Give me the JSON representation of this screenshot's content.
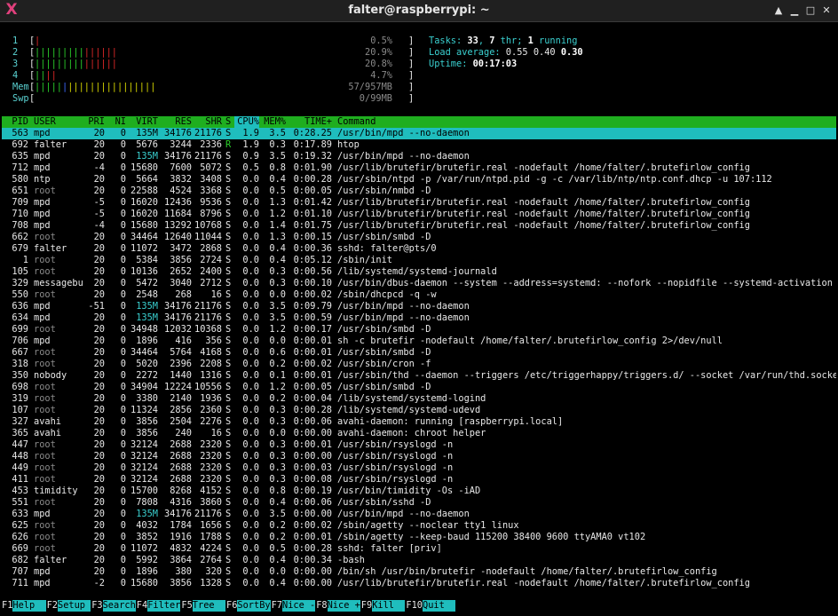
{
  "window": {
    "title": "falter@raspberrypi: ~"
  },
  "meters": {
    "cpus": [
      {
        "label": "1",
        "bars": "|",
        "value": "0.5%",
        "fraction": 0.005
      },
      {
        "label": "2",
        "bars": "|||||||||||||||",
        "value": "20.9%",
        "fraction": 0.209
      },
      {
        "label": "3",
        "bars": "|||||||||||||||",
        "value": "20.8%",
        "fraction": 0.208
      },
      {
        "label": "4",
        "bars": "||||",
        "value": "4.7%",
        "fraction": 0.047
      }
    ],
    "mem": {
      "label": "Mem",
      "bars_green": "|||||",
      "bars_blue": "|",
      "bars_yellow": "||||||||||||||||",
      "value": "57/957MB"
    },
    "swp": {
      "label": "Swp",
      "value": "0/99MB"
    }
  },
  "stats": {
    "tasks_label": "Tasks: ",
    "tasks": "33",
    "sep1": ", ",
    "threads": "7",
    "thr_label": " thr; ",
    "running": "1",
    "running_label": " running",
    "load_label": "Load average: ",
    "load1": "0.55",
    "load5": "0.40",
    "load15": "0.30",
    "uptime_label": "Uptime: ",
    "uptime": "00:17:03"
  },
  "columns": [
    "PID",
    "USER",
    "PRI",
    "NI",
    "VIRT",
    "RES",
    "SHR",
    "S",
    "CPU%",
    "MEM%",
    "TIME+",
    "Command"
  ],
  "processes": [
    [
      "563",
      "mpd",
      "20",
      "0",
      "135M",
      "34176",
      "21176",
      "S",
      "1.9",
      "3.5",
      "0:28.25",
      "/usr/bin/mpd --no-daemon"
    ],
    [
      "692",
      "falter",
      "20",
      "0",
      "5676",
      "3244",
      "2336",
      "R",
      "1.9",
      "0.3",
      "0:17.89",
      "htop"
    ],
    [
      "635",
      "mpd",
      "20",
      "0",
      "135M",
      "34176",
      "21176",
      "S",
      "0.9",
      "3.5",
      "0:19.32",
      "/usr/bin/mpd --no-daemon"
    ],
    [
      "712",
      "mpd",
      "-4",
      "0",
      "15680",
      "7600",
      "5072",
      "S",
      "0.5",
      "0.8",
      "0:01.90",
      "/usr/lib/brutefir/brutefir.real -nodefault /home/falter/.brutefirlow_config"
    ],
    [
      "580",
      "ntp",
      "20",
      "0",
      "5664",
      "3832",
      "3408",
      "S",
      "0.0",
      "0.4",
      "0:00.28",
      "/usr/sbin/ntpd -p /var/run/ntpd.pid -g -c /var/lib/ntp/ntp.conf.dhcp -u 107:112"
    ],
    [
      "651",
      "root",
      "20",
      "0",
      "22588",
      "4524",
      "3368",
      "S",
      "0.0",
      "0.5",
      "0:00.05",
      "/usr/sbin/nmbd -D"
    ],
    [
      "709",
      "mpd",
      "-5",
      "0",
      "16020",
      "12436",
      "9536",
      "S",
      "0.0",
      "1.3",
      "0:01.42",
      "/usr/lib/brutefir/brutefir.real -nodefault /home/falter/.brutefirlow_config"
    ],
    [
      "710",
      "mpd",
      "-5",
      "0",
      "16020",
      "11684",
      "8796",
      "S",
      "0.0",
      "1.2",
      "0:01.10",
      "/usr/lib/brutefir/brutefir.real -nodefault /home/falter/.brutefirlow_config"
    ],
    [
      "708",
      "mpd",
      "-4",
      "0",
      "15680",
      "13292",
      "10768",
      "S",
      "0.0",
      "1.4",
      "0:01.75",
      "/usr/lib/brutefir/brutefir.real -nodefault /home/falter/.brutefirlow_config"
    ],
    [
      "662",
      "root",
      "20",
      "0",
      "34464",
      "12640",
      "11044",
      "S",
      "0.0",
      "1.3",
      "0:00.15",
      "/usr/sbin/smbd -D"
    ],
    [
      "679",
      "falter",
      "20",
      "0",
      "11072",
      "3472",
      "2868",
      "S",
      "0.0",
      "0.4",
      "0:00.36",
      "sshd: falter@pts/0"
    ],
    [
      "1",
      "root",
      "20",
      "0",
      "5384",
      "3856",
      "2724",
      "S",
      "0.0",
      "0.4",
      "0:05.12",
      "/sbin/init"
    ],
    [
      "105",
      "root",
      "20",
      "0",
      "10136",
      "2652",
      "2400",
      "S",
      "0.0",
      "0.3",
      "0:00.56",
      "/lib/systemd/systemd-journald"
    ],
    [
      "329",
      "messagebu",
      "20",
      "0",
      "5472",
      "3040",
      "2712",
      "S",
      "0.0",
      "0.3",
      "0:00.10",
      "/usr/bin/dbus-daemon --system --address=systemd: --nofork --nopidfile --systemd-activation"
    ],
    [
      "550",
      "root",
      "20",
      "0",
      "2548",
      "268",
      "16",
      "S",
      "0.0",
      "0.0",
      "0:00.02",
      "/sbin/dhcpcd -q -w"
    ],
    [
      "636",
      "mpd",
      "-51",
      "0",
      "135M",
      "34176",
      "21176",
      "S",
      "0.0",
      "3.5",
      "0:09.79",
      "/usr/bin/mpd --no-daemon"
    ],
    [
      "634",
      "mpd",
      "20",
      "0",
      "135M",
      "34176",
      "21176",
      "S",
      "0.0",
      "3.5",
      "0:00.59",
      "/usr/bin/mpd --no-daemon"
    ],
    [
      "699",
      "root",
      "20",
      "0",
      "34948",
      "12032",
      "10368",
      "S",
      "0.0",
      "1.2",
      "0:00.17",
      "/usr/sbin/smbd -D"
    ],
    [
      "706",
      "mpd",
      "20",
      "0",
      "1896",
      "416",
      "356",
      "S",
      "0.0",
      "0.0",
      "0:00.01",
      "sh -c brutefir -nodefault /home/falter/.brutefirlow_config 2>/dev/null"
    ],
    [
      "667",
      "root",
      "20",
      "0",
      "34464",
      "5764",
      "4168",
      "S",
      "0.0",
      "0.6",
      "0:00.01",
      "/usr/sbin/smbd -D"
    ],
    [
      "318",
      "root",
      "20",
      "0",
      "5020",
      "2396",
      "2208",
      "S",
      "0.0",
      "0.2",
      "0:00.02",
      "/usr/sbin/cron -f"
    ],
    [
      "350",
      "nobody",
      "20",
      "0",
      "2272",
      "1440",
      "1316",
      "S",
      "0.0",
      "0.1",
      "0:00.01",
      "/usr/sbin/thd --daemon --triggers /etc/triggerhappy/triggers.d/ --socket /var/run/thd.socket"
    ],
    [
      "698",
      "root",
      "20",
      "0",
      "34904",
      "12224",
      "10556",
      "S",
      "0.0",
      "1.2",
      "0:00.05",
      "/usr/sbin/smbd -D"
    ],
    [
      "319",
      "root",
      "20",
      "0",
      "3380",
      "2140",
      "1936",
      "S",
      "0.0",
      "0.2",
      "0:00.04",
      "/lib/systemd/systemd-logind"
    ],
    [
      "107",
      "root",
      "20",
      "0",
      "11324",
      "2856",
      "2360",
      "S",
      "0.0",
      "0.3",
      "0:00.28",
      "/lib/systemd/systemd-udevd"
    ],
    [
      "327",
      "avahi",
      "20",
      "0",
      "3856",
      "2504",
      "2276",
      "S",
      "0.0",
      "0.3",
      "0:00.06",
      "avahi-daemon: running [raspberrypi.local]"
    ],
    [
      "365",
      "avahi",
      "20",
      "0",
      "3856",
      "240",
      "16",
      "S",
      "0.0",
      "0.0",
      "0:00.00",
      "avahi-daemon: chroot helper"
    ],
    [
      "447",
      "root",
      "20",
      "0",
      "32124",
      "2688",
      "2320",
      "S",
      "0.0",
      "0.3",
      "0:00.01",
      "/usr/sbin/rsyslogd -n"
    ],
    [
      "448",
      "root",
      "20",
      "0",
      "32124",
      "2688",
      "2320",
      "S",
      "0.0",
      "0.3",
      "0:00.00",
      "/usr/sbin/rsyslogd -n"
    ],
    [
      "449",
      "root",
      "20",
      "0",
      "32124",
      "2688",
      "2320",
      "S",
      "0.0",
      "0.3",
      "0:00.03",
      "/usr/sbin/rsyslogd -n"
    ],
    [
      "411",
      "root",
      "20",
      "0",
      "32124",
      "2688",
      "2320",
      "S",
      "0.0",
      "0.3",
      "0:00.08",
      "/usr/sbin/rsyslogd -n"
    ],
    [
      "453",
      "timidity",
      "20",
      "0",
      "15700",
      "8268",
      "4152",
      "S",
      "0.0",
      "0.8",
      "0:00.19",
      "/usr/bin/timidity -Os -iAD"
    ],
    [
      "551",
      "root",
      "20",
      "0",
      "7808",
      "4316",
      "3860",
      "S",
      "0.0",
      "0.4",
      "0:00.06",
      "/usr/sbin/sshd -D"
    ],
    [
      "633",
      "mpd",
      "20",
      "0",
      "135M",
      "34176",
      "21176",
      "S",
      "0.0",
      "3.5",
      "0:00.00",
      "/usr/bin/mpd --no-daemon"
    ],
    [
      "625",
      "root",
      "20",
      "0",
      "4032",
      "1784",
      "1656",
      "S",
      "0.0",
      "0.2",
      "0:00.02",
      "/sbin/agetty --noclear tty1 linux"
    ],
    [
      "626",
      "root",
      "20",
      "0",
      "3852",
      "1916",
      "1788",
      "S",
      "0.0",
      "0.2",
      "0:00.01",
      "/sbin/agetty --keep-baud 115200 38400 9600 ttyAMA0 vt102"
    ],
    [
      "669",
      "root",
      "20",
      "0",
      "11072",
      "4832",
      "4224",
      "S",
      "0.0",
      "0.5",
      "0:00.28",
      "sshd: falter [priv]"
    ],
    [
      "682",
      "falter",
      "20",
      "0",
      "5992",
      "3864",
      "2764",
      "S",
      "0.0",
      "0.4",
      "0:00.34",
      "-bash"
    ],
    [
      "707",
      "mpd",
      "20",
      "0",
      "1896",
      "380",
      "320",
      "S",
      "0.0",
      "0.0",
      "0:00.00",
      "/bin/sh /usr/bin/brutefir -nodefault /home/falter/.brutefirlow_config"
    ],
    [
      "711",
      "mpd",
      "-2",
      "0",
      "15680",
      "3856",
      "1328",
      "S",
      "0.0",
      "0.4",
      "0:00.00",
      "/usr/lib/brutefir/brutefir.real -nodefault /home/falter/.brutefirlow_config"
    ]
  ],
  "selected_index": 0,
  "function_bar": [
    {
      "key": "F1",
      "label": "Help  "
    },
    {
      "key": "F2",
      "label": "Setup "
    },
    {
      "key": "F3",
      "label": "Search"
    },
    {
      "key": "F4",
      "label": "Filter"
    },
    {
      "key": "F5",
      "label": "Tree  "
    },
    {
      "key": "F6",
      "label": "SortBy"
    },
    {
      "key": "F7",
      "label": "Nice -"
    },
    {
      "key": "F8",
      "label": "Nice +"
    },
    {
      "key": "F9",
      "label": "Kill  "
    },
    {
      "key": "F10",
      "label": "Quit  "
    }
  ],
  "colors": {
    "header_bg": "#1fae1f",
    "selected_bg": "#1fbdbd",
    "accent_cyan": "#3ad0d0"
  }
}
